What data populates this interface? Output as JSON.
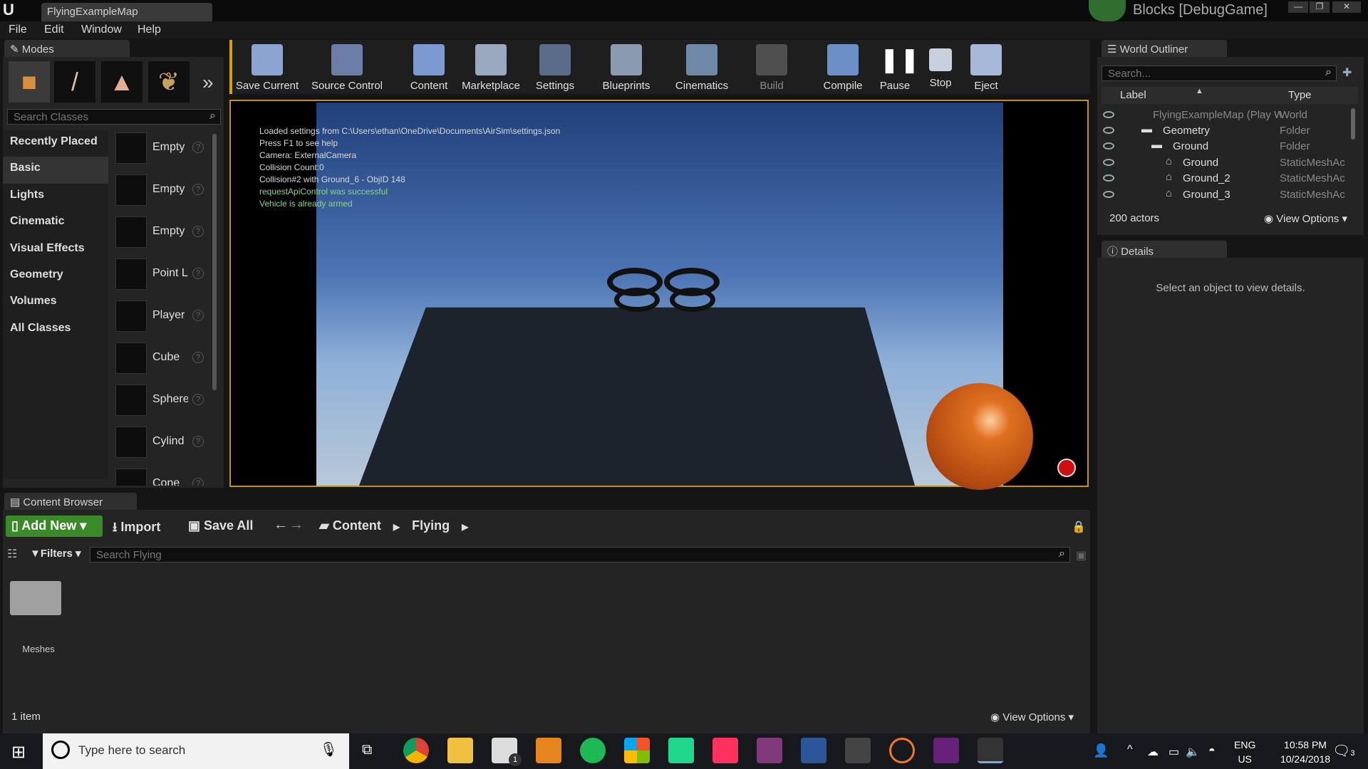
{
  "window": {
    "tab_title": "FlyingExampleMap",
    "project": "Blocks [DebugGame]"
  },
  "menu": [
    "File",
    "Edit",
    "Window",
    "Help"
  ],
  "modes": {
    "tab": "Modes",
    "search_placeholder": "Search Classes",
    "categories": [
      "Recently Placed",
      "Basic",
      "Lights",
      "Cinematic",
      "Visual Effects",
      "Geometry",
      "Volumes",
      "All Classes"
    ],
    "assets": [
      "Empty",
      "Empty",
      "Empty",
      "Point L",
      "Player",
      "Cube",
      "Sphere",
      "Cylind",
      "Cone"
    ]
  },
  "toolbar": [
    "Save Current",
    "Source Control",
    "Content",
    "Marketplace",
    "Settings",
    "Blueprints",
    "Cinematics",
    "Build",
    "Compile",
    "Pause",
    "Stop",
    "Eject"
  ],
  "viewport": {
    "messages": [
      "Loaded settings from C:\\Users\\ethan\\OneDrive\\Documents\\AirSim\\settings.json",
      "Press F1 to see help",
      "Camera: ExternalCamera",
      "Collision Count:0",
      "Collision#2 with Ground_6 - ObjID 148"
    ],
    "green_messages": [
      "requestApiControl was successful",
      "Vehicle is already armed"
    ]
  },
  "outliner": {
    "tab": "World Outliner",
    "search_placeholder": "Search...",
    "col_label": "Label",
    "col_type": "Type",
    "rows": [
      {
        "label": "FlyingExampleMap (Play World",
        "type": "World"
      },
      {
        "label": "Geometry",
        "type": "Folder"
      },
      {
        "label": "Ground",
        "type": "Folder"
      },
      {
        "label": "Ground",
        "type": "StaticMeshAc"
      },
      {
        "label": "Ground_2",
        "type": "StaticMeshAc"
      },
      {
        "label": "Ground_3",
        "type": "StaticMeshAc"
      }
    ],
    "count": "200 actors",
    "view_options": "View Options"
  },
  "details": {
    "tab": "Details",
    "empty_msg": "Select an object to view details."
  },
  "content_browser": {
    "tab": "Content Browser",
    "add_new": "Add New",
    "import": "Import",
    "save_all": "Save All",
    "path": [
      "Content",
      "Flying"
    ],
    "filters": "Filters",
    "search_placeholder": "Search Flying",
    "folder": "Meshes",
    "count": "1 item",
    "view_options": "View Options"
  },
  "taskbar": {
    "search_placeholder": "Type here to search",
    "lang": "ENG",
    "region": "US",
    "time": "10:58 PM",
    "date": "10/24/2018",
    "notif": "3",
    "mail_badge": "1"
  }
}
